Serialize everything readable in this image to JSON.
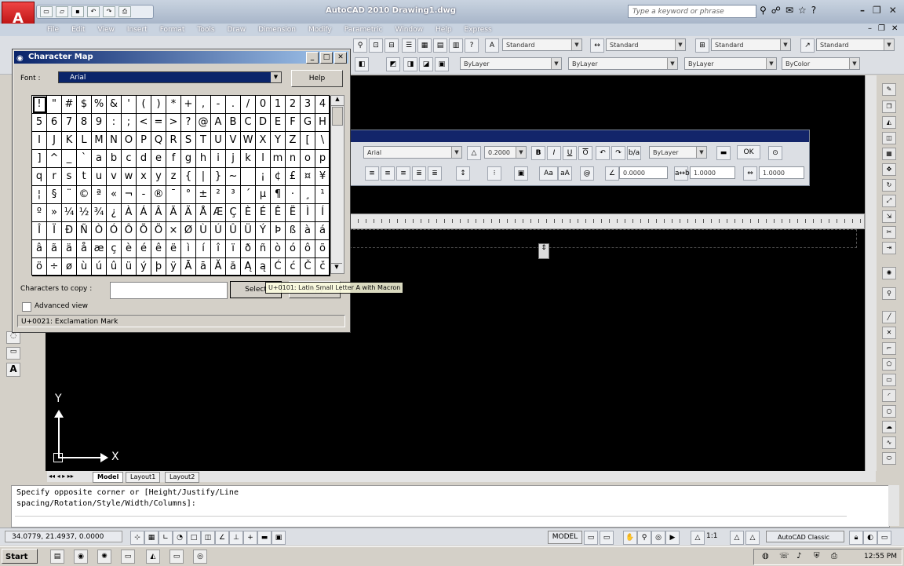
{
  "window": {
    "title": "AutoCAD 2010    Drawing1.dwg"
  },
  "search": {
    "placeholder": "Type a keyword or phrase"
  },
  "menu": [
    "File",
    "Edit",
    "View",
    "Insert",
    "Format",
    "Tools",
    "Draw",
    "Dimension",
    "Modify",
    "Parametric",
    "Window",
    "Help",
    "Express"
  ],
  "toolbar": {
    "text_style": "Standard",
    "dim_style": "Standard",
    "table_style": "Standard",
    "mleader_style": "Standard",
    "layer_color": "ByLayer",
    "linetype": "ByLayer",
    "lineweight": "ByLayer",
    "plot_style": "ByColor"
  },
  "text_format": {
    "font": "Arial",
    "height": "0.2000",
    "color": "ByLayer",
    "ok_label": "OK",
    "oblique": "0.0000",
    "tracking": "1.0000",
    "width": "1.0000"
  },
  "charmap": {
    "title": "Character Map",
    "font_label": "Font :",
    "font_value": "Arial",
    "help_label": "Help",
    "characters": [
      "!",
      "\"",
      "#",
      "$",
      "%",
      "&",
      "'",
      "(",
      ")",
      "*",
      "+",
      ",",
      "-",
      ".",
      "/",
      "0",
      "1",
      "2",
      "3",
      "4",
      "5",
      "6",
      "7",
      "8",
      "9",
      ":",
      ";",
      "<",
      "=",
      ">",
      "?",
      "@",
      "A",
      "B",
      "C",
      "D",
      "E",
      "F",
      "G",
      "H",
      "I",
      "J",
      "K",
      "L",
      "M",
      "N",
      "O",
      "P",
      "Q",
      "R",
      "S",
      "T",
      "U",
      "V",
      "W",
      "X",
      "Y",
      "Z",
      "[",
      "\\",
      "]",
      "^",
      "_",
      "`",
      "a",
      "b",
      "c",
      "d",
      "e",
      "f",
      "g",
      "h",
      "i",
      "j",
      "k",
      "l",
      "m",
      "n",
      "o",
      "p",
      "q",
      "r",
      "s",
      "t",
      "u",
      "v",
      "w",
      "x",
      "y",
      "z",
      "{",
      "|",
      "}",
      "~",
      " ",
      "¡",
      "¢",
      "£",
      "¤",
      "¥",
      "¦",
      "§",
      "¨",
      "©",
      "ª",
      "«",
      "¬",
      "-",
      "®",
      "¯",
      "°",
      "±",
      "²",
      "³",
      "´",
      "µ",
      "¶",
      "·",
      "¸",
      "¹",
      "º",
      "»",
      "¼",
      "½",
      "¾",
      "¿",
      "À",
      "Á",
      "Â",
      "Ã",
      "Ä",
      "Å",
      "Æ",
      "Ç",
      "È",
      "É",
      "Ê",
      "Ë",
      "Ì",
      "Í",
      "Î",
      "Ï",
      "Ð",
      "Ñ",
      "Ò",
      "Ó",
      "Ô",
      "Õ",
      "Ö",
      "×",
      "Ø",
      "Ù",
      "Ú",
      "Û",
      "Ü",
      "Ý",
      "Þ",
      "ß",
      "à",
      "á",
      "â",
      "ã",
      "ä",
      "å",
      "æ",
      "ç",
      "è",
      "é",
      "ê",
      "ë",
      "ì",
      "í",
      "î",
      "ï",
      "ð",
      "ñ",
      "ò",
      "ó",
      "ô",
      "õ",
      "ö",
      "÷",
      "ø",
      "ù",
      "ú",
      "û",
      "ü",
      "ý",
      "þ",
      "ÿ",
      "Ā",
      "ā",
      "Ă",
      "ă",
      "Ą",
      "ą",
      "Ć",
      "ć",
      "Č",
      "č"
    ],
    "copy_label": "Characters to copy :",
    "select_label": "Select",
    "copy_button_label": "Copy",
    "tooltip": "U+0101: Latin Small Letter A with Macron",
    "advanced_label": "Advanced view",
    "status": "U+0021: Exclamation Mark"
  },
  "layout_tabs": [
    "Model",
    "Layout1",
    "Layout2"
  ],
  "ucs": {
    "x_label": "X",
    "y_label": "Y"
  },
  "command": {
    "text": "Specify opposite corner or [Height/Justify/Line\nspacing/Rotation/Style/Width/Columns]:"
  },
  "status": {
    "coords": "34.0779, 21.4937, 0.0000",
    "model": "MODEL",
    "scale": "1:1",
    "workspace": "AutoCAD Classic"
  },
  "taskbar": {
    "start": "Start",
    "clock": "12:55 PM"
  }
}
